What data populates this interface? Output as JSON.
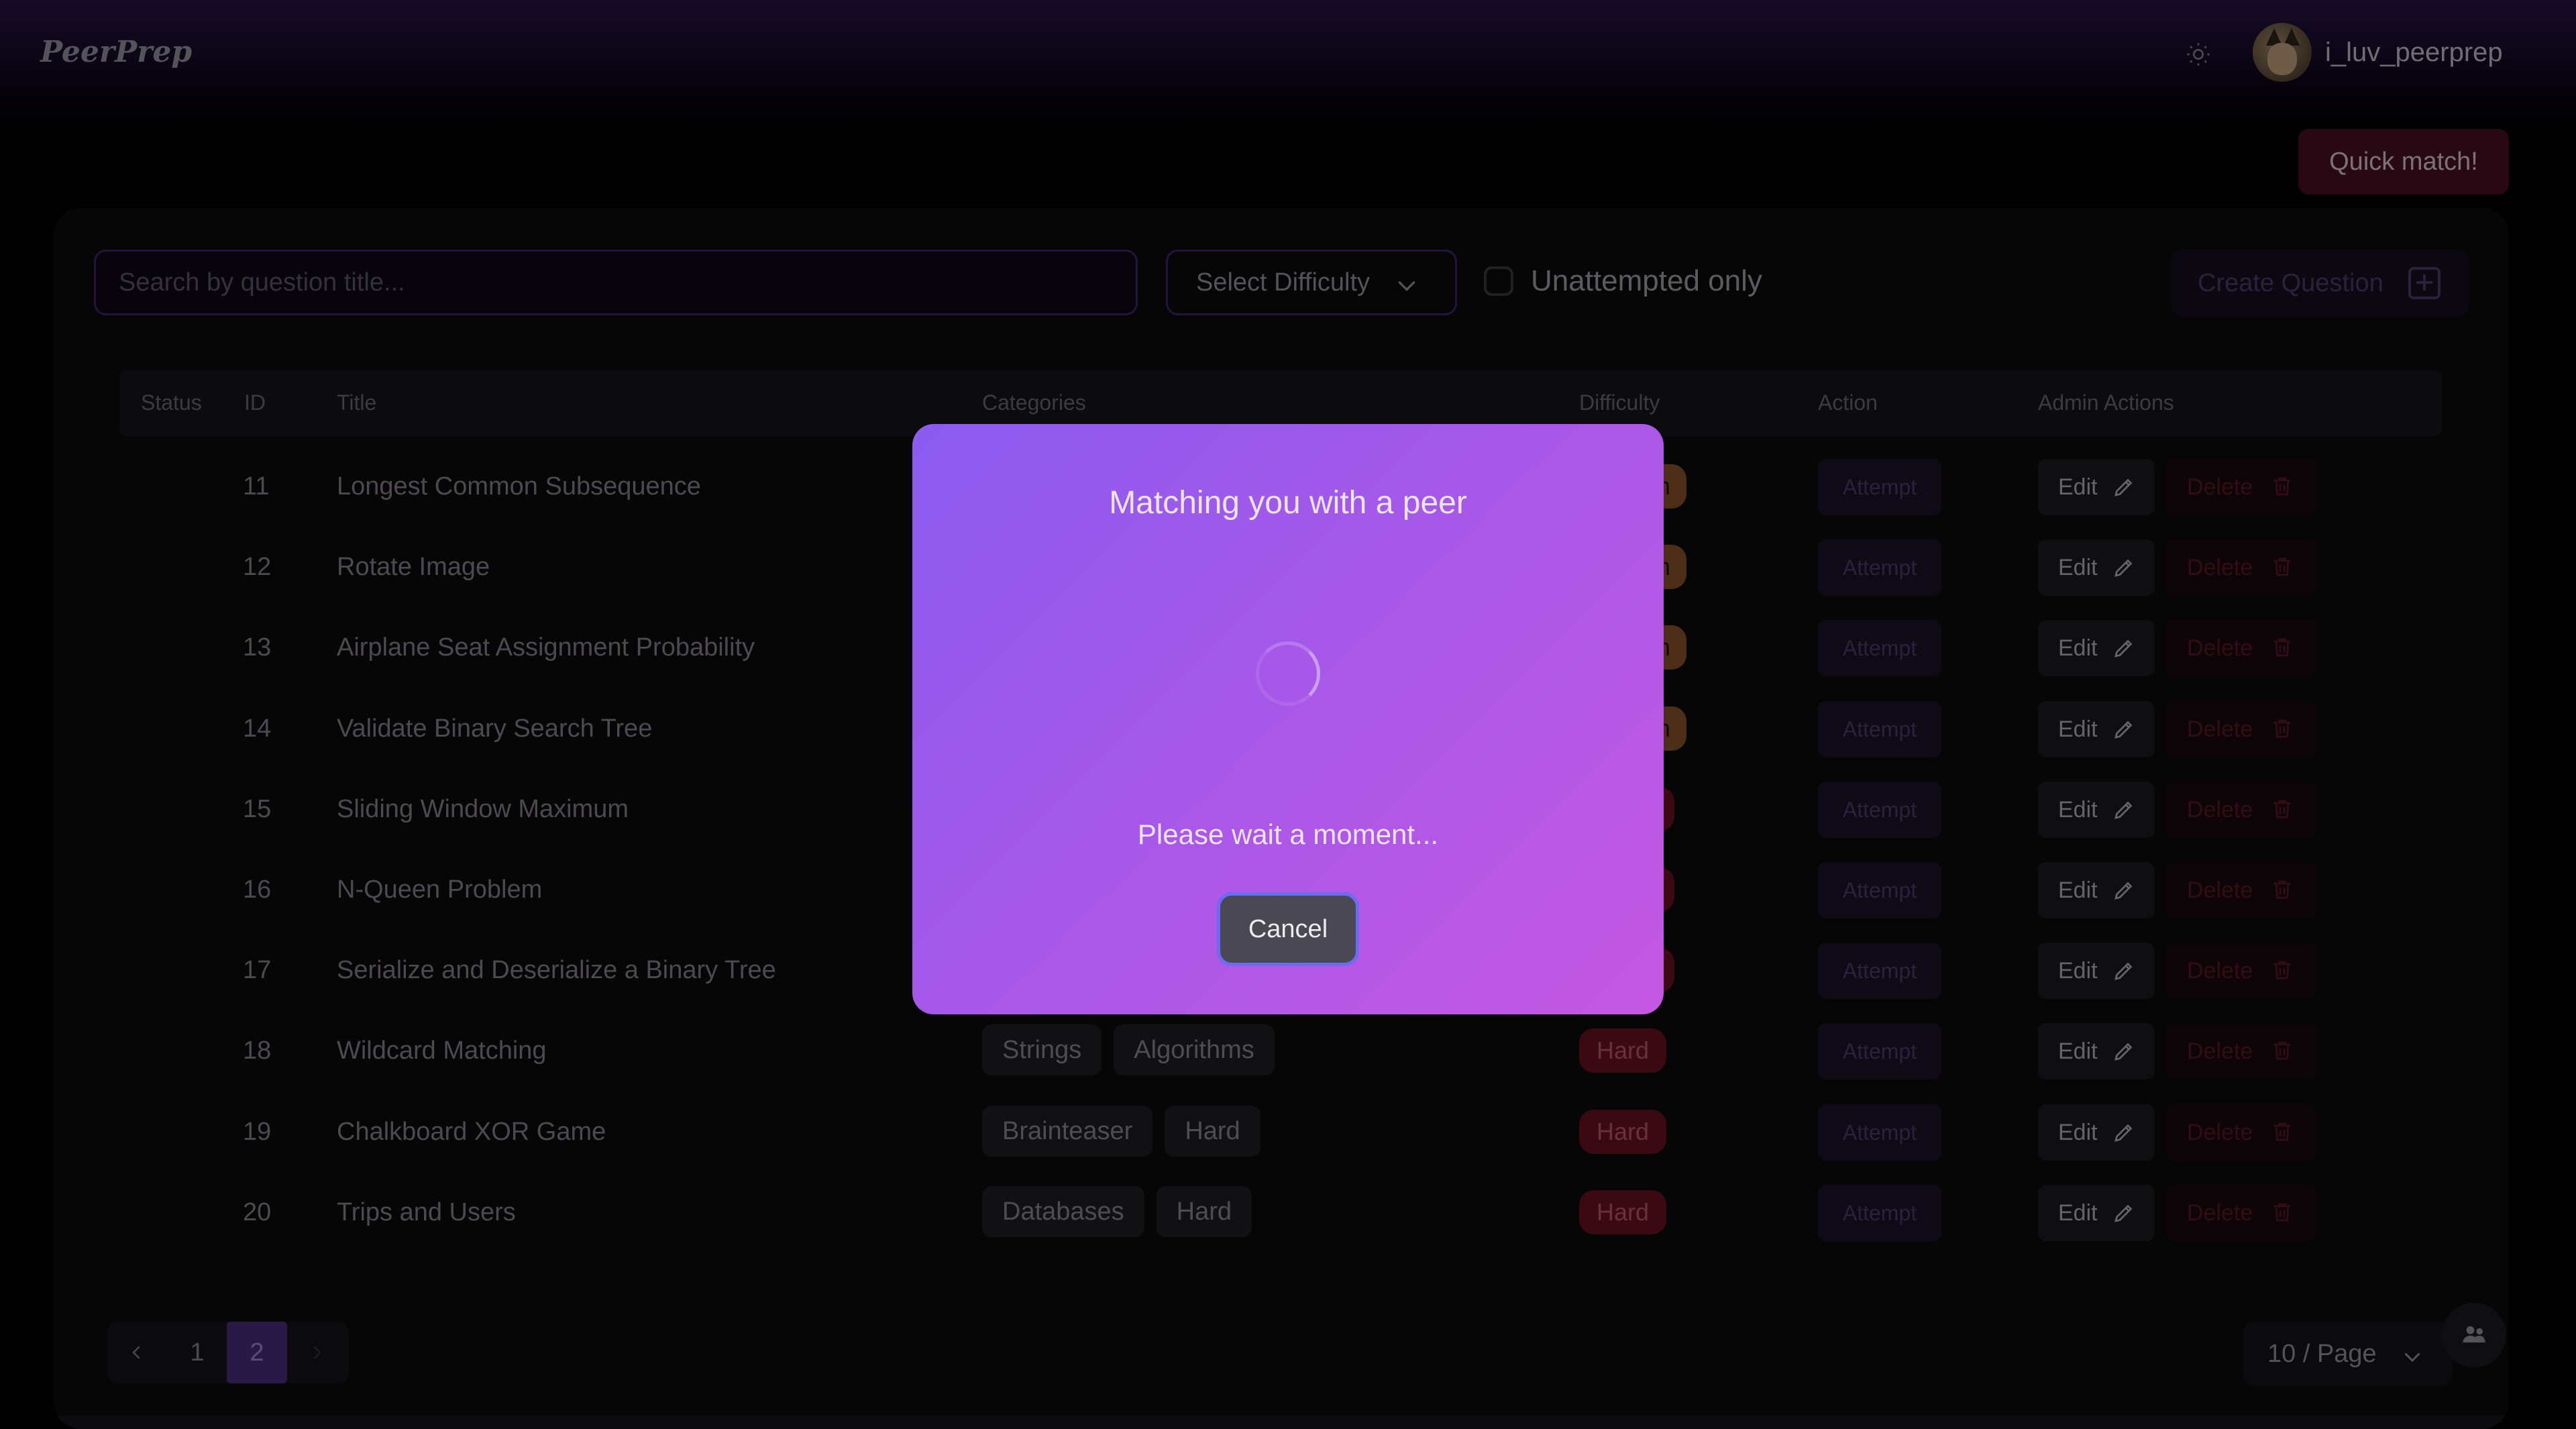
{
  "header": {
    "logo": "PeerPrep",
    "username": "i_luv_peerprep"
  },
  "quick_match_label": "Quick match!",
  "toolbar": {
    "search_placeholder": "Search by question title...",
    "difficulty_label": "Select Difficulty",
    "unattempted_label": "Unattempted only",
    "create_label": "Create Question"
  },
  "table": {
    "headers": [
      "Status",
      "ID",
      "Title",
      "Categories",
      "Difficulty",
      "Action",
      "Admin Actions"
    ],
    "rows": [
      {
        "id": "11",
        "title": "Longest Common Subsequence",
        "categories": [],
        "difficulty": "Medium",
        "difficulty_visible": "um"
      },
      {
        "id": "12",
        "title": "Rotate Image",
        "categories": [],
        "difficulty": "Medium",
        "difficulty_visible": "um"
      },
      {
        "id": "13",
        "title": "Airplane Seat Assignment Probability",
        "categories": [],
        "difficulty": "Medium",
        "difficulty_visible": "um"
      },
      {
        "id": "14",
        "title": "Validate Binary Search Tree",
        "categories": [],
        "difficulty": "Medium",
        "difficulty_visible": "um"
      },
      {
        "id": "15",
        "title": "Sliding Window Maximum",
        "categories": [],
        "difficulty": "Hard",
        "difficulty_visible": ""
      },
      {
        "id": "16",
        "title": "N-Queen Problem",
        "categories": [],
        "difficulty": "Hard",
        "difficulty_visible": ""
      },
      {
        "id": "17",
        "title": "Serialize and Deserialize a Binary Tree",
        "categories": [],
        "difficulty": "Hard",
        "difficulty_visible": ""
      },
      {
        "id": "18",
        "title": "Wildcard Matching",
        "categories": [
          "Strings",
          "Algorithms"
        ],
        "difficulty": "Hard",
        "difficulty_visible": "Hard"
      },
      {
        "id": "19",
        "title": "Chalkboard XOR Game",
        "categories": [
          "Brainteaser",
          "Hard"
        ],
        "difficulty": "Hard",
        "difficulty_visible": "Hard"
      },
      {
        "id": "20",
        "title": "Trips and Users",
        "categories": [
          "Databases",
          "Hard"
        ],
        "difficulty": "Hard",
        "difficulty_visible": "Hard"
      }
    ],
    "attempt_label": "Attempt",
    "edit_label": "Edit",
    "delete_label": "Delete"
  },
  "pagination": {
    "pages": [
      "1",
      "2"
    ],
    "current": "2",
    "per_page": "10 / Page"
  },
  "modal": {
    "title": "Matching you with a peer",
    "message": "Please wait a moment...",
    "cancel_label": "Cancel"
  },
  "colors": {
    "accent": "#8b5cf0",
    "modal_end": "#c457e2",
    "medium": "#8a5628",
    "hard": "#6c1122"
  },
  "icons": [
    "sun-icon",
    "chevron-down-icon",
    "plus-square-icon",
    "pencil-icon",
    "trash-icon",
    "chevron-left-icon",
    "chevron-right-icon",
    "users-icon",
    "spinner-icon"
  ]
}
